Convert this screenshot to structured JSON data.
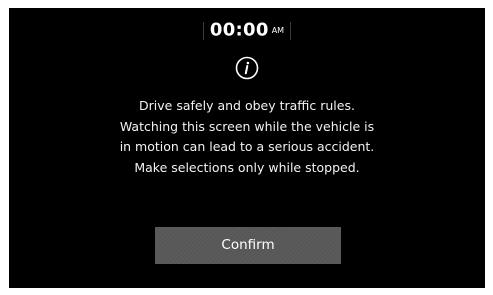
{
  "status_bar": {
    "time": "00:00",
    "period": "AM"
  },
  "dialog": {
    "icon": "info-icon",
    "message_lines": [
      "Drive safely and obey traffic rules.",
      "Watching this screen while the vehicle is",
      "in motion can lead to a serious accident.",
      "Make selections only while stopped."
    ],
    "confirm_label": "Confirm"
  },
  "colors": {
    "background": "#000000",
    "text": "#ffffff",
    "button": "#575757"
  }
}
